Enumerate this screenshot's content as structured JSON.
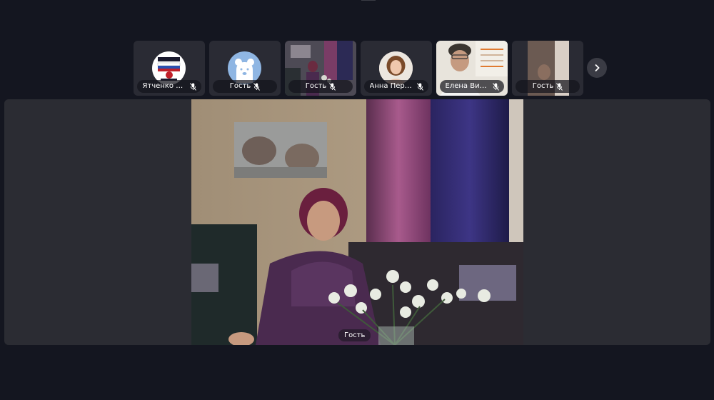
{
  "participants": [
    {
      "name": "Ятченко О...",
      "type": "avatar",
      "avatar": "logo-badge",
      "mic": "muted"
    },
    {
      "name": "Гость",
      "type": "avatar",
      "avatar": "bear",
      "mic": "muted"
    },
    {
      "name": "Гость",
      "type": "video",
      "mic": "muted"
    },
    {
      "name": "Анна Пере...",
      "type": "avatar",
      "avatar": "photo",
      "mic": "muted"
    },
    {
      "name": "Елена Вик...",
      "type": "video",
      "mic": "muted"
    },
    {
      "name": "Гость",
      "type": "video",
      "mic": "muted"
    }
  ],
  "strip_next_icon": "chevron-right-icon",
  "main_speaker": {
    "name": "Гость"
  },
  "colors": {
    "background": "#141620",
    "tile": "#2a2b34",
    "bear_avatar": "#8fb6e3"
  }
}
